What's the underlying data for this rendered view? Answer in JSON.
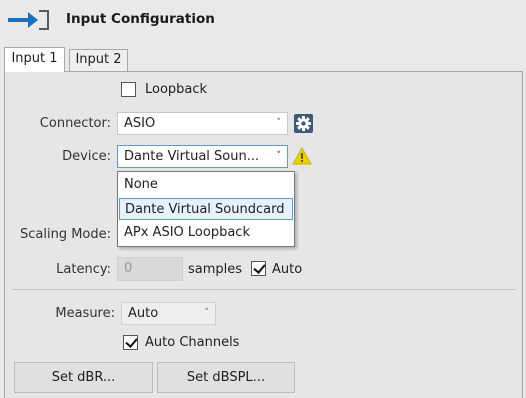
{
  "header": {
    "title": "Input Configuration",
    "icon": "input-arrow-icon"
  },
  "tabs": [
    {
      "label": "Input 1",
      "active": true
    },
    {
      "label": "Input 2",
      "active": false
    }
  ],
  "loopback": {
    "label": "Loopback",
    "checked": false
  },
  "connector": {
    "label": "Connector:",
    "value": "ASIO",
    "settings_icon": "gear-icon"
  },
  "device": {
    "label": "Device:",
    "value": "Dante Virtual Soun...",
    "warning_icon": "warning-icon"
  },
  "device_dropdown": {
    "options": [
      "None",
      "Dante Virtual Soundcard",
      "APx ASIO Loopback"
    ],
    "highlighted": "Dante Virtual Soundcard"
  },
  "scaling_mode": {
    "label": "Scaling Mode:"
  },
  "latency": {
    "label": "Latency:",
    "value": "0",
    "units": "samples",
    "auto_label": "Auto",
    "auto_checked": true
  },
  "measure": {
    "label": "Measure:",
    "value": "Auto"
  },
  "auto_channels": {
    "label": "Auto Channels",
    "checked": true
  },
  "buttons": {
    "set_dbr": "Set dBR...",
    "set_dbspl": "Set dBSPL..."
  },
  "colors": {
    "accent_blue": "#1f6fb8",
    "warning_yellow": "#e0c000",
    "highlight_border": "#5b9bd5",
    "highlight_bg": "#e5f1fb"
  }
}
